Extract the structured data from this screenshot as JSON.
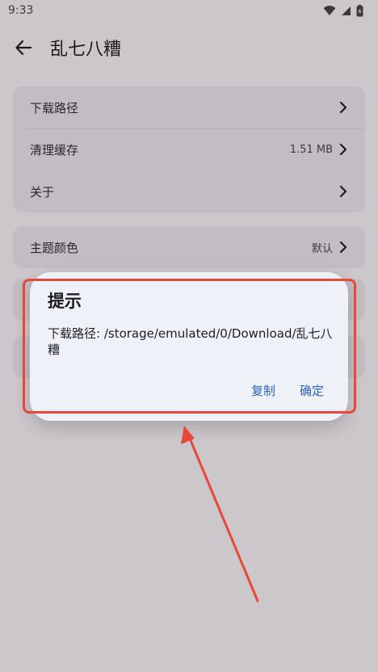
{
  "status_bar": {
    "time": "9:33",
    "icons": [
      "wifi-icon",
      "signal-icon",
      "battery-icon"
    ]
  },
  "app_bar": {
    "back_icon": "arrow-left-icon",
    "title": "乱七八糟"
  },
  "settings": {
    "group1": [
      {
        "label": "下载路径",
        "value": ""
      },
      {
        "label": "清理缓存",
        "value": "1.51 MB"
      },
      {
        "label": "关于",
        "value": ""
      }
    ],
    "group2": [
      {
        "label": "主题颜色",
        "value": "默认"
      }
    ]
  },
  "dialog": {
    "title": "提示",
    "message": "下载路径: /storage/emulated/0/Download/乱七八糟",
    "copy_label": "复制",
    "ok_label": "确定"
  },
  "colors": {
    "accent": "#2f62b8",
    "annotation": "#e8483a",
    "background": "#cbc7cb"
  }
}
